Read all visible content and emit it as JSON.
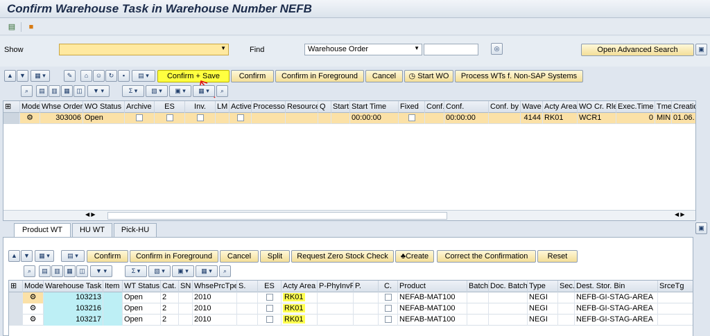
{
  "window": {
    "title": "Confirm Warehouse Task in Warehouse Number NEFB"
  },
  "selection": {
    "show_label": "Show",
    "show_value": "",
    "find_label": "Find",
    "find_value": "Warehouse Order",
    "find_input": "",
    "advanced_search": "Open Advanced Search"
  },
  "toolbar1": {
    "confirm_save": "Confirm + Save",
    "confirm": "Confirm",
    "confirm_fg": "Confirm in Foreground",
    "cancel": "Cancel",
    "start_wo": "Start WO",
    "process_wts": "Process WTs f. Non-SAP Systems"
  },
  "grid1": {
    "columns": [
      "Mode",
      "Whse Order",
      "WO Status",
      "Archive",
      "ES",
      "Inv.",
      "LM",
      "Active",
      "Processor",
      "Resource",
      "Q",
      "Start",
      "Start Time",
      "Fixed",
      "Conf.",
      "Conf.",
      "Conf. by",
      "Wave",
      "Acty Area",
      "WO Cr. Rle",
      "Exec.Time",
      "Tme",
      "Creatio"
    ],
    "row": {
      "whse_order": "303006",
      "wo_status": "Open",
      "start_time": "00:00:00",
      "conf_time": "00:00:00",
      "wave": "4144",
      "acty_area": "RK01",
      "wo_cr_rle": "WCR1",
      "exec_time": "0",
      "tme": "MIN",
      "creation": "01.06."
    }
  },
  "tabs": [
    "Product WT",
    "HU WT",
    "Pick-HU"
  ],
  "toolbar2": {
    "confirm": "Confirm",
    "confirm_fg": "Confirm in Foreground",
    "cancel": "Cancel",
    "split": "Split",
    "zero_stock": "Request Zero Stock Check",
    "create": "Create",
    "correct": "Correct the Confirmation",
    "reset": "Reset"
  },
  "grid2": {
    "columns": [
      "Mode",
      "Warehouse Task",
      "Item",
      "WT Status",
      "Cat.",
      "SN",
      "WhsePrcTpe",
      "S.",
      "ES",
      "Acty Area",
      "P-PhyInvPl",
      "P.",
      "C.",
      "Product",
      "Batch",
      "Doc. Batch",
      "Type",
      "Sec.",
      "Dest. Stor. Bin",
      "SrceTg"
    ],
    "rows": [
      {
        "task": "103213",
        "status": "Open",
        "cat": "2",
        "prc": "2010",
        "area": "RK01",
        "product": "NEFAB-MAT100",
        "type": "NEGI",
        "bin": "NEFB-GI-STAG-AREA"
      },
      {
        "task": "103216",
        "status": "Open",
        "cat": "2",
        "prc": "2010",
        "area": "RK01",
        "product": "NEFAB-MAT100",
        "type": "NEGI",
        "bin": "NEFB-GI-STAG-AREA"
      },
      {
        "task": "103217",
        "status": "Open",
        "cat": "2",
        "prc": "2010",
        "area": "RK01",
        "product": "NEFAB-MAT100",
        "type": "NEGI",
        "bin": "NEFB-GI-STAG-AREA"
      }
    ]
  }
}
